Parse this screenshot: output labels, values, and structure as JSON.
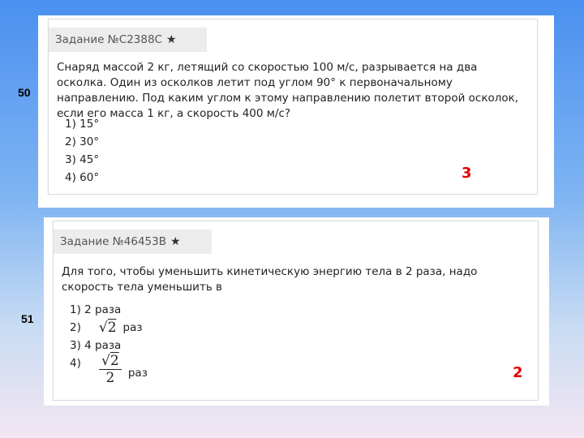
{
  "task50": {
    "number_label": "50",
    "header": "Задание №C2388C",
    "question": "Снаряд массой 2 кг, летящий со скоростью 100 м/с, разрывается на два осколка. Один из осколков летит под углом 90° к первоначальному направлению. Под каким углом к этому направлению полетит второй осколок, если его масса 1 кг, а скорость 400 м/с?",
    "options": [
      "1) 15°",
      "2) 30°",
      "3) 45°",
      "4) 60°"
    ],
    "answer": "3"
  },
  "task51": {
    "number_label": "51",
    "header": "Задание №46453B",
    "question": "Для того, чтобы уменьшить кинетическую энергию тела в 2 раза, надо скорость тела уменьшить в",
    "options": {
      "o1": "1) 2 раза",
      "o2_prefix": "2)",
      "o2_radicand": "2",
      "o2_suffix": "раз",
      "o3": "3) 4 раза",
      "o4_prefix": "4)",
      "o4_radicand": "2",
      "o4_denominator": "2",
      "o4_suffix": "раз"
    },
    "answer": "2"
  },
  "star_icon": "star-icon",
  "colors": {
    "answer": "#e00000",
    "header_bg": "#ececec"
  }
}
